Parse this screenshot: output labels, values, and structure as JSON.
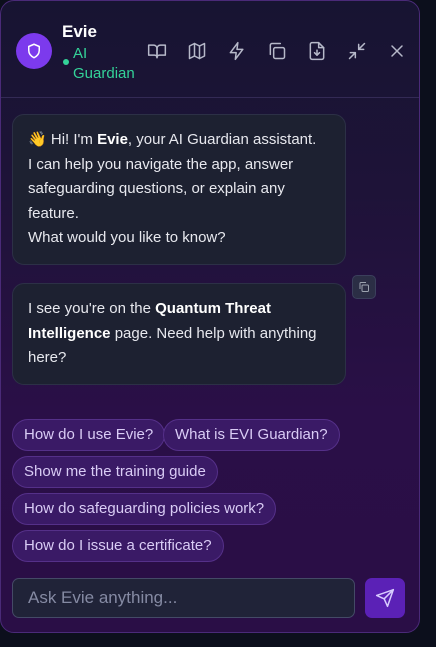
{
  "header": {
    "name": "Evie",
    "status": "AI Guardian",
    "icons": [
      "book-open-icon",
      "map-icon",
      "zap-icon",
      "copy-icon",
      "file-download-icon",
      "minimize-icon",
      "close-icon"
    ]
  },
  "messages": [
    {
      "wave": "👋",
      "l1_pre": " Hi! I'm ",
      "l1_bold": "Evie",
      "l1_post": ", your AI Guardian assistant.",
      "l2": "I can help you navigate the app, answer safeguarding questions, or explain any feature.",
      "l3": "What would you like to know?"
    },
    {
      "pre": "I see you're on the ",
      "bold": "Quantum Threat Intelligence",
      "post": " page. Need help with anything here?"
    }
  ],
  "suggestions": [
    "How do I use Evie?",
    "What is EVI Guardian?",
    "Show me the training guide",
    "How do safeguarding policies work?",
    "How do I issue a certificate?"
  ],
  "composer": {
    "placeholder": "Ask Evie anything...",
    "value": ""
  },
  "colors": {
    "accent": "#7c3aed",
    "status": "#34d399",
    "chip_bg": "#3a1a66",
    "send_bg": "#5b21b6"
  }
}
